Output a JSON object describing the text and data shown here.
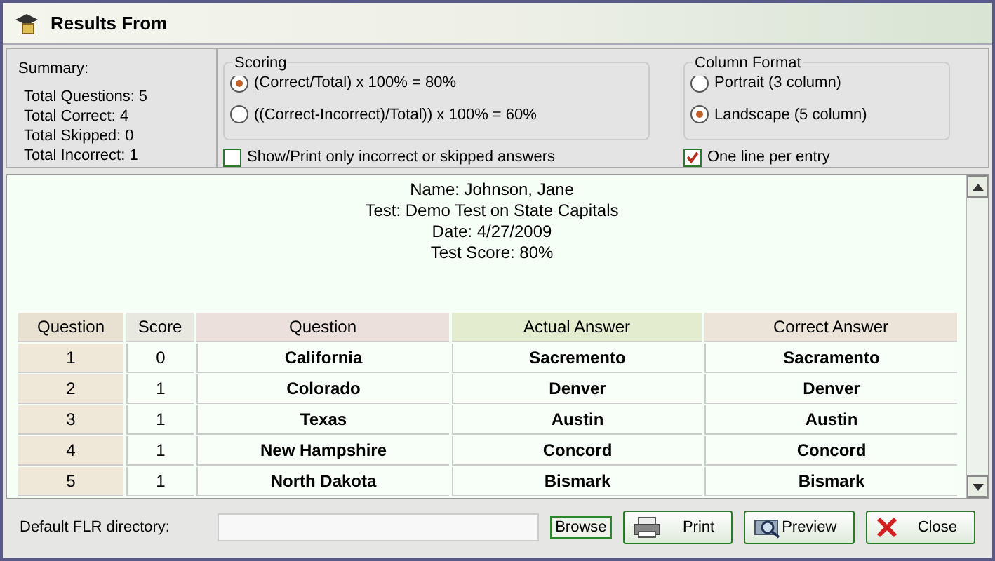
{
  "window": {
    "title": "Results From"
  },
  "summary": {
    "heading": "Summary:",
    "lines": [
      "Total Questions: 5",
      "Total Correct: 4",
      "Total Skipped: 0",
      "Total Incorrect: 1"
    ]
  },
  "scoring": {
    "heading": "Scoring",
    "options": [
      {
        "label": "(Correct/Total) x 100% = 80%",
        "selected": true
      },
      {
        "label": "((Correct-Incorrect)/Total)) x 100% = 60%",
        "selected": false
      }
    ]
  },
  "column_format": {
    "heading": "Column Format",
    "options": [
      {
        "label": "Portrait (3 column)",
        "selected": false
      },
      {
        "label": "Landscape (5 column)",
        "selected": true
      }
    ]
  },
  "show_only_incorrect": {
    "label": "Show/Print only incorrect or skipped answers",
    "checked": false
  },
  "one_line": {
    "label": "One line per entry",
    "checked": true
  },
  "report": {
    "header": [
      "Name: Johnson, Jane",
      "Test: Demo Test on State Capitals",
      "Date: 4/27/2009",
      "Test Score: 80%"
    ],
    "columns": [
      "Question",
      "Score",
      "Question",
      "Actual Answer",
      "Correct Answer"
    ],
    "rows": [
      [
        "1",
        "0",
        "California",
        "Sacremento",
        "Sacramento"
      ],
      [
        "2",
        "1",
        "Colorado",
        "Denver",
        "Denver"
      ],
      [
        "3",
        "1",
        "Texas",
        "Austin",
        "Austin"
      ],
      [
        "4",
        "1",
        "New Hampshire",
        "Concord",
        "Concord"
      ],
      [
        "5",
        "1",
        "North Dakota",
        "Bismark",
        "Bismark"
      ]
    ]
  },
  "footer": {
    "directory_label": "Default FLR directory:",
    "browse": "Browse",
    "buttons": [
      {
        "kind": "print",
        "label": "Print"
      },
      {
        "kind": "preview",
        "label": "Preview"
      },
      {
        "kind": "close",
        "label": "Close"
      }
    ]
  }
}
